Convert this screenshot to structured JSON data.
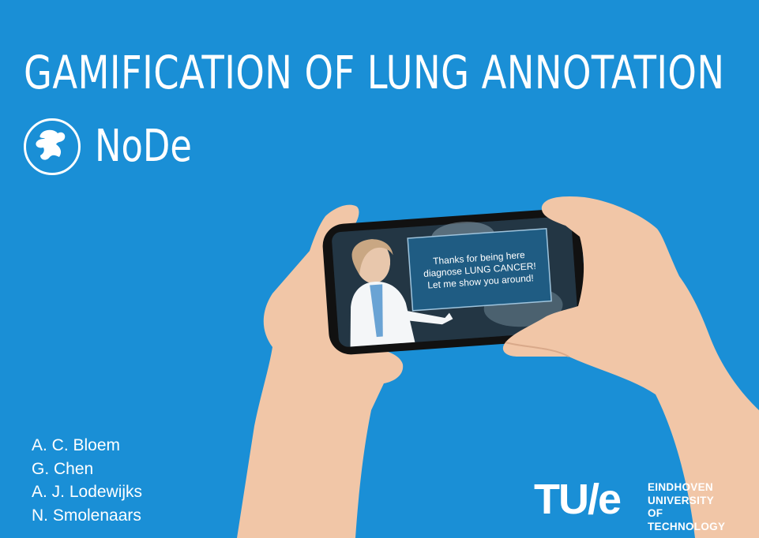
{
  "slide": {
    "title": "GAMIFICATION OF LUNG ANNOTATION",
    "brand": "NoDe",
    "authors": [
      "A. C. Bloem",
      "G. Chen",
      "A. J. Lodewijks",
      "N. Smolenaars"
    ]
  },
  "phone": {
    "message": [
      "Thanks for being here",
      "diagnose LUNG CANCER!",
      "Let me show you around!"
    ]
  },
  "university": {
    "logo_mark": "TU/e",
    "name_lines": [
      "EINDHOVEN",
      "UNIVERSITY OF",
      "TECHNOLOGY"
    ]
  },
  "colors": {
    "background": "#1a8fd6",
    "text": "#ffffff",
    "skin": "#f1c6a7"
  },
  "icons": {
    "node_logo": "mascot-logo-icon"
  }
}
